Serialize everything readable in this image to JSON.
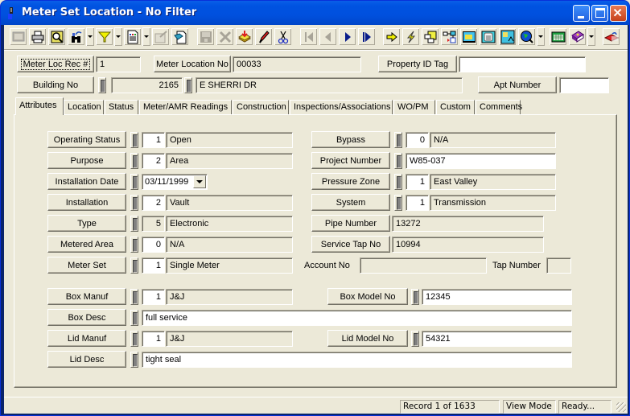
{
  "window": {
    "title": "Meter Set Location - No Filter",
    "controls": [
      "minimize",
      "maximize",
      "close"
    ]
  },
  "toolbar": {
    "items": [
      {
        "name": "select-icon",
        "enabled": false
      },
      {
        "name": "print-icon",
        "enabled": true
      },
      {
        "name": "print-preview-icon",
        "enabled": true
      },
      {
        "name": "find-icon",
        "enabled": true,
        "dropdown": true
      },
      {
        "name": "filter-icon",
        "enabled": true,
        "dropdown": true
      },
      {
        "name": "report-icon",
        "enabled": true,
        "dropdown": true
      },
      {
        "name": "properties-icon",
        "enabled": false
      },
      {
        "name": "copy-record-icon",
        "enabled": true
      },
      {
        "name": "save-icon",
        "enabled": false
      },
      {
        "name": "delete-icon",
        "enabled": false
      },
      {
        "name": "add-record-icon",
        "enabled": true
      },
      {
        "name": "edit-icon",
        "enabled": true
      },
      {
        "name": "cut-icon",
        "enabled": true
      },
      {
        "name": "first-record-icon",
        "enabled": false
      },
      {
        "name": "previous-record-icon",
        "enabled": false
      },
      {
        "name": "next-record-icon",
        "enabled": true
      },
      {
        "name": "last-record-icon",
        "enabled": true
      },
      {
        "name": "goto-icon",
        "enabled": true
      },
      {
        "name": "quick-action-icon",
        "enabled": true
      },
      {
        "name": "related-forms-icon",
        "enabled": true
      },
      {
        "name": "workflow-icon",
        "enabled": true
      },
      {
        "name": "image-icon",
        "enabled": true
      },
      {
        "name": "calculator-icon",
        "enabled": true
      },
      {
        "name": "map-icon",
        "enabled": true
      },
      {
        "name": "gis-globe-icon",
        "enabled": true,
        "dropdown": true
      },
      {
        "name": "spreadsheet-icon",
        "enabled": true
      },
      {
        "name": "help-book-icon",
        "enabled": true,
        "dropdown": true
      },
      {
        "name": "exit-icon",
        "enabled": true
      }
    ]
  },
  "header": {
    "meter_loc_rec_label": "Meter Loc Rec #",
    "meter_loc_rec_value": "1",
    "meter_location_no_label": "Meter Location No",
    "meter_location_no_value": "00033",
    "property_id_tag_label": "Property ID Tag",
    "property_id_tag_value": "",
    "building_no_label": "Building No",
    "building_no_value": "2165",
    "street_value": "E SHERRI DR",
    "apt_number_label": "Apt Number",
    "apt_number_value": ""
  },
  "tabs": [
    {
      "label": "Attributes",
      "active": true
    },
    {
      "label": "Location"
    },
    {
      "label": "Status"
    },
    {
      "label": "Meter/AMR Readings"
    },
    {
      "label": "Construction"
    },
    {
      "label": "Inspections/Associations"
    },
    {
      "label": "WO/PM"
    },
    {
      "label": "Custom"
    },
    {
      "label": "Comments"
    }
  ],
  "attributes": {
    "left": [
      {
        "label": "Operating Status",
        "code": "1",
        "desc": "Open"
      },
      {
        "label": "Purpose",
        "code": "2",
        "desc": "Area"
      },
      {
        "label": "Installation Date",
        "date": "03/11/1999"
      },
      {
        "label": "Installation",
        "code": "2",
        "desc": "Vault"
      },
      {
        "label": "Type",
        "code": "5",
        "desc": "Electronic"
      },
      {
        "label": "Metered Area",
        "code": "0",
        "desc": "N/A"
      },
      {
        "label": "Meter Set",
        "code": "1",
        "desc": "Single Meter"
      }
    ],
    "right": [
      {
        "label": "Bypass",
        "code": "0",
        "desc": "N/A"
      },
      {
        "label": "Project Number",
        "value": "W85-037"
      },
      {
        "label": "Pressure Zone",
        "code": "1",
        "desc": "East Valley"
      },
      {
        "label": "System",
        "code": "1",
        "desc": "Transmission"
      },
      {
        "label": "Pipe Number",
        "value": "13272"
      },
      {
        "label": "Service Tap No",
        "value": "10994"
      }
    ],
    "account_no_label": "Account No",
    "account_no_value": "",
    "tap_number_label": "Tap Number",
    "tap_number_value": "",
    "box_manuf": {
      "label": "Box Manuf",
      "code": "1",
      "desc": "J&J"
    },
    "box_model_no": {
      "label": "Box Model No",
      "value": "12345"
    },
    "box_desc": {
      "label": "Box Desc",
      "value": "full service"
    },
    "lid_manuf": {
      "label": "Lid Manuf",
      "code": "1",
      "desc": "J&J"
    },
    "lid_model_no": {
      "label": "Lid Model No",
      "value": "54321"
    },
    "lid_desc": {
      "label": "Lid Desc",
      "value": "tight seal"
    }
  },
  "statusbar": {
    "record": "Record 1 of 1633",
    "mode": "View Mode",
    "state": "Ready..."
  }
}
